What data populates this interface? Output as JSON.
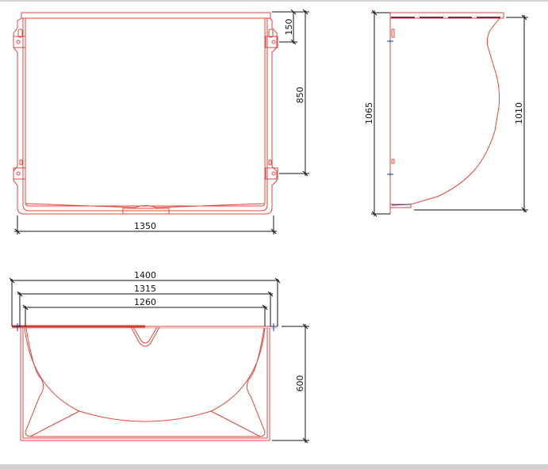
{
  "views": {
    "top": {
      "dimensions": {
        "width": "1350",
        "bracket_offset": "150",
        "bracket_spacing": "850"
      }
    },
    "side": {
      "dimensions": {
        "overall_height": "1065",
        "bowl_height": "1010"
      }
    },
    "front": {
      "dimensions": {
        "overall_width": "1400",
        "mid_width": "1315",
        "inner_width": "1260",
        "depth": "600"
      }
    }
  },
  "colors": {
    "outline": "#e0463c",
    "dimension": "#111111",
    "marker": "#2b3a8a"
  }
}
